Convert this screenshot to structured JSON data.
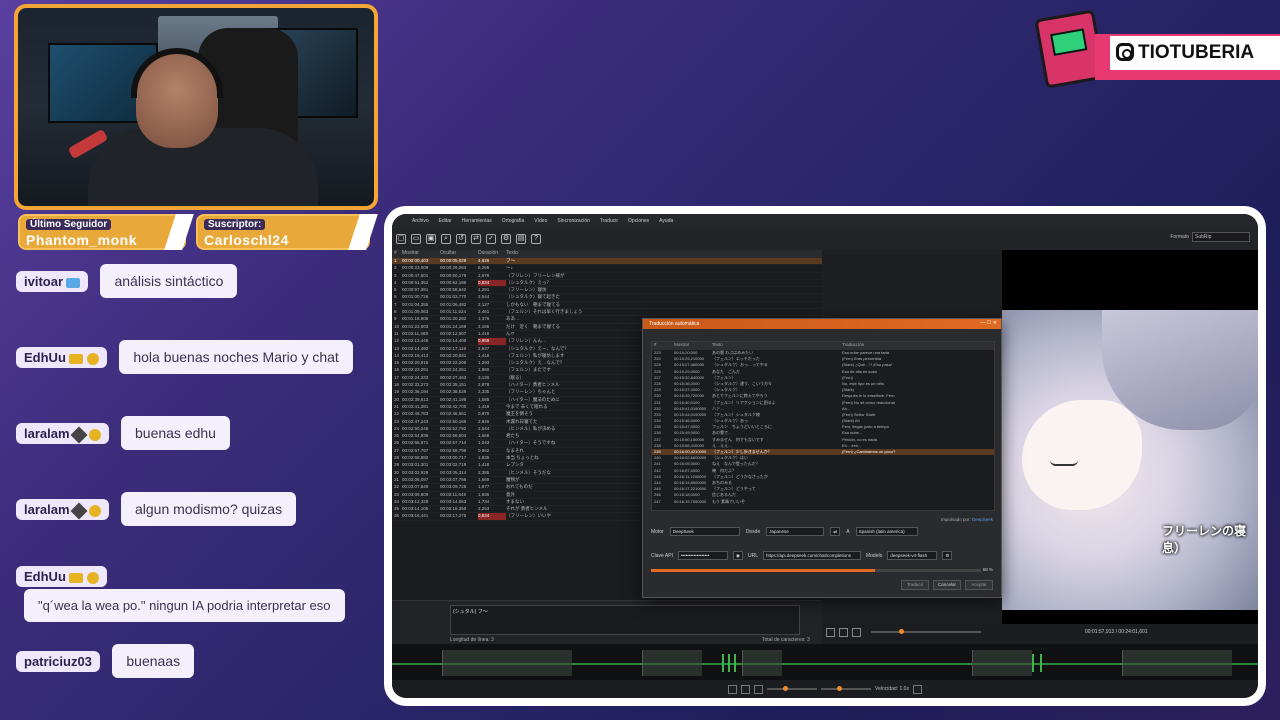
{
  "stream": {
    "follower_label": "Último Seguidor",
    "follower_name": "Phantom_monk",
    "subscriber_label": "Suscriptor:",
    "subscriber_name": "Carloschl24",
    "logo_text": "TIOTUBERIA"
  },
  "chat": [
    {
      "user": "ivitoar",
      "text": "análisis sintáctico"
    },
    {
      "user": "EdhUu",
      "text": "hola buenas noches Mario y chat"
    },
    {
      "user": "laralam",
      "text": "buenas edhu"
    },
    {
      "user": "laralam",
      "text": "algun modismo? quizas"
    },
    {
      "user": "EdhUu",
      "text": "\"q´wea la wea po.\" ningun IA podria interpretar eso"
    },
    {
      "user": "patriciuz03",
      "text": "buenaas"
    }
  ],
  "app": {
    "menu": [
      "Archivo",
      "Editar",
      "Herramientas",
      "Ortografía",
      "Vídeo",
      "Sincronización",
      "Traducir",
      "Opciones",
      "Ayuda"
    ],
    "format_label": "Formato",
    "format_value": "SubRip",
    "grid_headers": [
      "#",
      "Mostrar",
      "Ocultar",
      "Duración",
      "Texto"
    ],
    "rows": [
      {
        "n": "1",
        "s": "00:00:00,403",
        "e": "00:00:05,029",
        "d": "4,626",
        "t": "フ〜",
        "sel": true
      },
      {
        "n": "2",
        "s": "00:00:23,009",
        "e": "00:00:29,264",
        "d": "6,255",
        "t": "〜♪"
      },
      {
        "n": "3",
        "s": "00:00:47,501",
        "e": "00:00:50,179",
        "d": "2,678",
        "t": "（フリレン）フリーレン様が"
      },
      {
        "n": "4",
        "s": "00:00:51,352",
        "e": "00:00:52,186",
        "d": "0,834",
        "t": "（シュタルク）えっ？",
        "warn": true
      },
      {
        "n": "5",
        "s": "00:00:57,391",
        "e": "00:00:58,642",
        "d": "1,251",
        "t": "（フリーレン）寝坊"
      },
      {
        "n": "6",
        "s": "00:01:00,726",
        "e": "00:01:03,770",
        "d": "2,544",
        "t": "（シュタルク）寝て起きた"
      },
      {
        "n": "7",
        "s": "00:01:04,355",
        "e": "00:01:06,482",
        "d": "2,127",
        "t": "しかもない　朝まで寝てる"
      },
      {
        "n": "8",
        "s": "00:01:09,063",
        "e": "00:01:11,524",
        "d": "2,461",
        "t": "（フェルン）それは早く行きましょう"
      },
      {
        "n": "9",
        "s": "00:01:18,906",
        "e": "00:01:20,282",
        "d": "1,376",
        "t": "ああ…"
      },
      {
        "n": "10",
        "s": "00:01:22,003",
        "e": "00:01:24,169",
        "d": "2,166",
        "t": "だけ　近く　朝まで寝てる"
      },
      {
        "n": "11",
        "s": "00:02:11,488",
        "e": "00:02:12,907",
        "d": "1,418",
        "t": "ん!?"
      },
      {
        "n": "12",
        "s": "00:02:13,449",
        "e": "00:02:14,408",
        "d": "0,959",
        "t": "（フリレン）んん…",
        "warn": true
      },
      {
        "n": "13",
        "s": "00:02:14,492",
        "e": "00:02:17,119",
        "d": "2,627",
        "t": "（シュタルク）えー、なんで？"
      },
      {
        "n": "14",
        "s": "00:02:19,413",
        "e": "00:02:20,831",
        "d": "1,418",
        "t": "（フェルン）私が寝坊します"
      },
      {
        "n": "15",
        "s": "00:02:20,915",
        "e": "00:02:22,208",
        "d": "1,293",
        "t": "（シュタルク）え…なんで？"
      },
      {
        "n": "16",
        "s": "00:02:22,291",
        "e": "00:02:24,251",
        "d": "1,960",
        "t": "（フェルン）またです"
      },
      {
        "n": "17",
        "s": "00:02:24,333",
        "e": "00:02:27,463",
        "d": "3,130",
        "t": "（眠る）"
      },
      {
        "n": "18",
        "s": "00:02:32,273",
        "e": "00:02:35,151",
        "d": "2,878",
        "t": "（ハイター）勇者ヒンメル"
      },
      {
        "n": "19",
        "s": "00:02:36,194",
        "e": "00:02:38,529",
        "d": "2,335",
        "t": "（フリーレン）ちゃんと"
      },
      {
        "n": "20",
        "s": "00:02:39,613",
        "e": "00:02:41,198",
        "d": "1,585",
        "t": "（ハイター）魔法のために"
      },
      {
        "n": "21",
        "s": "00:02:41,281",
        "e": "00:02:42,700",
        "d": "1,419",
        "t": "今まで 辛くて眠れる"
      },
      {
        "n": "22",
        "s": "00:02:45,783",
        "e": "00:02:46,661",
        "d": "0,878",
        "t": "魔王を倒そう"
      },
      {
        "n": "23",
        "s": "00:02:47,243",
        "e": "00:02:50,169",
        "d": "2,926",
        "t": "木漏れ日寝てた"
      },
      {
        "n": "24",
        "s": "00:02:50,248",
        "e": "00:02:52,792",
        "d": "2,544",
        "t": "（ヒンメル）私が決める"
      },
      {
        "n": "25",
        "s": "00:02:54,836",
        "e": "00:02:56,504",
        "d": "1,668",
        "t": "君たち"
      },
      {
        "n": "26",
        "s": "00:02:56,671",
        "e": "00:02:57,714",
        "d": "1,043",
        "t": "（ハイター）そうですね"
      },
      {
        "n": "27",
        "s": "00:02:57,797",
        "e": "00:02:58,799",
        "d": "0,962",
        "t": "なまそれ"
      },
      {
        "n": "28",
        "s": "00:02:58,882",
        "e": "00:03:00,717",
        "d": "1,835",
        "t": "本当 ちょっとね"
      },
      {
        "n": "29",
        "s": "00:03:01,301",
        "e": "00:03:02,719",
        "d": "1,418",
        "t": "レプシタ"
      },
      {
        "n": "30",
        "s": "00:03:02,929",
        "e": "00:03:05,314",
        "d": "2,385",
        "t": "（ヒンメル）そうだな"
      },
      {
        "n": "31",
        "s": "00:03:06,097",
        "e": "00:03:07,766",
        "d": "1,669",
        "t": "魔物が"
      },
      {
        "n": "32",
        "s": "00:03:07,849",
        "e": "00:03:09,726",
        "d": "1,877",
        "t": "おれてものだ"
      },
      {
        "n": "33",
        "s": "00:03:09,809",
        "e": "00:03:11,645",
        "d": "1,836",
        "t": "意外"
      },
      {
        "n": "34",
        "s": "00:03:12,329",
        "e": "00:03:14,063",
        "d": "1,734",
        "t": "すまない"
      },
      {
        "n": "35",
        "s": "00:03:14,105",
        "e": "00:03:16,358",
        "d": "2,253",
        "t": "それが 勇者ヒンメル"
      },
      {
        "n": "36",
        "s": "00:03:16,441",
        "e": "00:03:17,275",
        "d": "0,834",
        "t": "（フリーレン）いいや",
        "warn": true
      }
    ],
    "edit_text": "(シュタル) フ〜",
    "line_length": "Longitud de línea: 3",
    "total_chars": "Total de caracteres: 3",
    "subtitle_overlay": "フリーレンの寝息）",
    "time_display": "00:01:57,913 / 00:24:01,601",
    "speed_label": "Velocidad: 1.0x",
    "dialog": {
      "title": "Traducción automática",
      "window_buttons": "— ☐ ✕",
      "headers": [
        "#",
        "Mostrar",
        "Texto",
        "Traducción"
      ],
      "rows": [
        {
          "n": "223",
          "s": "00:15:20,000",
          "t": "あの雲 わぶはめみたい",
          "tr": "Esa nube parece una tarta"
        },
        {
          "n": "224",
          "s": "00:15:25,210000",
          "t": "（フェルン）エッチだった",
          "tr": "(Fern) Eras pervertida"
        },
        {
          "n": "225",
          "s": "00:15:27,460000",
          "t": "（シュタルク）おっ…ってやる",
          "tr": "(Stark) ¿Qué...?! ¡Eso pasa!"
        },
        {
          "n": "226",
          "s": "00:15:29,0000",
          "t": "あなた　ごんだ",
          "tr": "Esa de alla es sosa"
        },
        {
          "n": "227",
          "s": "00:15:32,840000",
          "t": "（フェルン）",
          "tr": "(Fern)"
        },
        {
          "n": "228",
          "s": "00:15:36,0000",
          "t": "（シュタルク）違う、こいう方々",
          "tr": "No, este tipo es un niño"
        },
        {
          "n": "229",
          "s": "00:15:37,0000",
          "t": "（シュタルク）",
          "tr": "(Stark)"
        },
        {
          "n": "230",
          "s": "00:15:39,720000",
          "t": "あとでフェルンに教えてやろう",
          "tr": "Después le lo enseñaré, Fern"
        },
        {
          "n": "231",
          "s": "00:15:40,0100",
          "t": "（フェルン）リアクションに困るよ",
          "tr": "(Fern) No sé cómo reaccionar"
        },
        {
          "n": "232",
          "s": "00:15:41,0190000",
          "t": "ハァ…",
          "tr": "Ah..."
        },
        {
          "n": "233",
          "s": "00:15:44,0190000",
          "t": "（フェルン）シュタルク様",
          "tr": "(Fern) Señor Stark"
        },
        {
          "n": "234",
          "s": "00:15:46,0000",
          "t": "（シュタルク）あっ",
          "tr": "(Stark) Ah"
        },
        {
          "n": "235",
          "s": "00:15:47,0000",
          "t": "フェルン　ちょうどいいところに",
          "tr": "Fern, llegas justo a tiempo"
        },
        {
          "n": "236",
          "s": "00:15:49,0000",
          "t": "あの雲で…",
          "tr": "Esa nube..."
        },
        {
          "n": "237",
          "s": "00:15:50,150000",
          "t": "すみません　何でもないです",
          "tr": "Perdón, no es nada"
        },
        {
          "n": "238",
          "s": "00:15:56,410000",
          "t": "え…ええ…",
          "tr": "Eh... eeh..."
        },
        {
          "n": "239",
          "s": "00:16:00,4210000",
          "t": "（フェルン）少し歩きませんか？",
          "tr": "(Fern) ¿Caminamos un poco?",
          "sel": true
        },
        {
          "n": "240",
          "s": "00:16:02,6600000",
          "t": "（シュタルク）はい",
          "tr": ""
        },
        {
          "n": "241",
          "s": "00:16:05,0000",
          "t": "ねえ　なんで登ったんだ？",
          "tr": ""
        },
        {
          "n": "242",
          "s": "00:16:07,0000",
          "t": "俺　何だよ？",
          "tr": ""
        },
        {
          "n": "243",
          "s": "00:16:11,1200000",
          "t": "（フェルン）どうかなさったか",
          "tr": ""
        },
        {
          "n": "244",
          "s": "00:16:14,8500000",
          "t": "あちのみる",
          "tr": ""
        },
        {
          "n": "245",
          "s": "00:16:17,2210000",
          "t": "（フェルン）どうやって",
          "tr": ""
        },
        {
          "n": "246",
          "s": "00:16:18,0000",
          "t": "信じあるんだ",
          "tr": ""
        },
        {
          "n": "247",
          "s": "00:16:19,7550000",
          "t": "もう 素晴でいいぞ",
          "tr": ""
        }
      ],
      "impulsed_by": "Impulsado por:",
      "impulsed_link": "DeepSeek",
      "motor_label": "Motor",
      "motor_value": "DeepSeek",
      "from_label": "Desde",
      "from_value": "Japanese",
      "to_label": "A",
      "to_value": "Spanish (latin america)",
      "api_key_label": "Clave API",
      "api_key_value": "••••••••••••••••••",
      "url_label": "URL",
      "url_value": "https://api.deepseek.com/chat/completions",
      "model_label": "Modelo",
      "model_value": "deepseek-v4-flash",
      "progress": 0.68,
      "progress_text": "68 %",
      "btn_translate": "Traducir",
      "btn_cancel": "Cancelar",
      "btn_accept": "Aceptar"
    }
  }
}
